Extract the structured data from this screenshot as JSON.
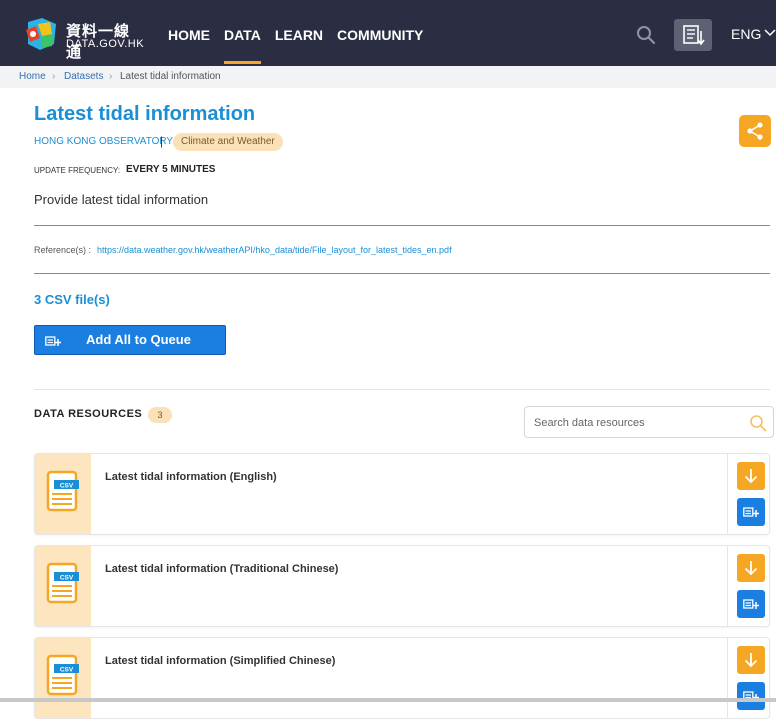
{
  "header": {
    "logo_cn": "資料一線通",
    "logo_en": "DATA.GOV.HK",
    "nav": [
      "HOME",
      "DATA",
      "LEARN",
      "COMMUNITY"
    ],
    "active_nav": "DATA",
    "lang": "ENG"
  },
  "breadcrumb": {
    "home": "Home",
    "datasets": "Datasets",
    "current": "Latest tidal information"
  },
  "dataset": {
    "title": "Latest tidal information",
    "org": "HONG KONG OBSERVATORY",
    "separator": "|",
    "category": "Climate and Weather",
    "freq_label": "UPDATE FREQUENCY:",
    "freq_value": "EVERY 5 MINUTES",
    "description": "Provide latest tidal information",
    "ref_label": "Reference(s) :",
    "ref_url": "https://data.weather.gov.hk/weatherAPI/hko_data/tide/File_layout_for_latest_tides_en.pdf",
    "files_count": "3 CSV file(s)",
    "add_all_label": "Add All to Queue"
  },
  "resources": {
    "label": "DATA RESOURCES",
    "count": "3",
    "search_placeholder": "Search data resources",
    "file_type": "CSV",
    "items": [
      {
        "title": "Latest tidal information (English)"
      },
      {
        "title": "Latest tidal information (Traditional Chinese)"
      },
      {
        "title": "Latest tidal information (Simplified Chinese)"
      }
    ]
  },
  "colors": {
    "header_bg": "#2b2e42",
    "accent_orange": "#f5a623",
    "link_blue": "#1a8fd6",
    "button_blue": "#1a7fe0",
    "tag_bg": "#fbe1b8"
  },
  "icons": [
    "logo-icon",
    "search-icon",
    "queue-icon",
    "chevron-down-icon",
    "share-icon",
    "add-queue-icon",
    "csv-file-icon",
    "download-icon"
  ]
}
